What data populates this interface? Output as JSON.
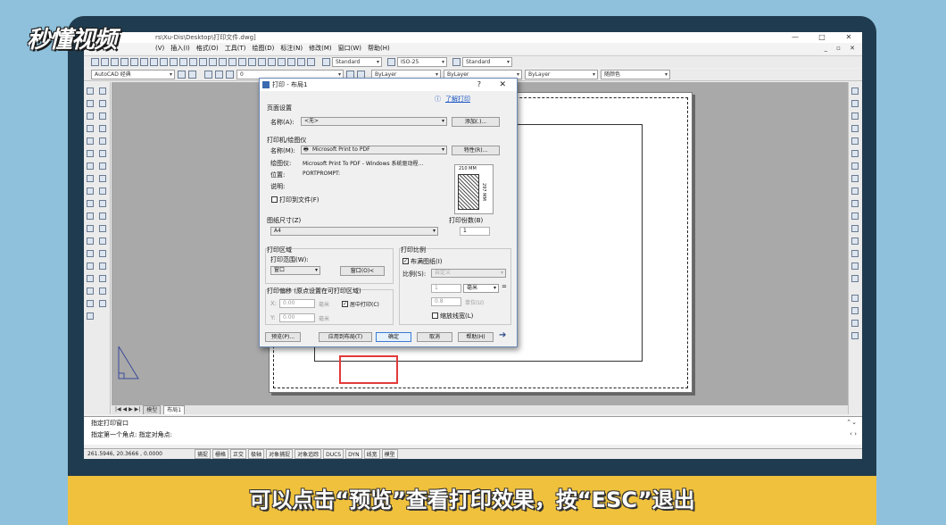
{
  "logo": {
    "text": "秒懂视频"
  },
  "titlebar": {
    "title": "rs\\Xu-Dis\\Desktop\\打印文件.dwg]",
    "min": "—",
    "max": "□",
    "close": "✕"
  },
  "menubar": {
    "items": [
      "(V)",
      "插入(I)",
      "格式(O)",
      "工具(T)",
      "绘图(D)",
      "标注(N)",
      "修改(M)",
      "窗口(W)",
      "帮助(H)"
    ],
    "mdi_controls": "_ ▫ ✕"
  },
  "toolbar1": {
    "style_text": "Standard",
    "dim_style": "ISO-25",
    "table_style": "Standard"
  },
  "toolbar2": {
    "workspace": "AutoCAD 经典",
    "layer": "0",
    "color": "ByLayer",
    "linetype": "ByLayer",
    "lineweight": "ByLayer",
    "plotstyle": "随颜色"
  },
  "layout_tabs": {
    "nav": "|◀ ◀ ▶ ▶|",
    "tabs": [
      "模型",
      "布局1"
    ]
  },
  "command": {
    "line1": "指定打印窗口",
    "line2": "指定第一个角点: 指定对角点:"
  },
  "status": {
    "coords": "261.5946, 20.3666 , 0.0000",
    "toggles": [
      "捕捉",
      "栅格",
      "正交",
      "极轴",
      "对象捕捉",
      "对象追踪",
      "DUCS",
      "DYN",
      "线宽",
      "模型"
    ]
  },
  "dialog": {
    "title": "打印 - 布局1",
    "help_q": "?",
    "close": "✕",
    "learn_link": "了解打印",
    "page_setup": {
      "group": "页面设置",
      "name_label": "名称(A):",
      "name_value": "<无>",
      "add_btn": "添加(.)..."
    },
    "printer": {
      "group": "打印机/绘图仪",
      "name_label": "名称(M):",
      "name_value": "Microsoft Print to PDF",
      "props_btn": "特性(R)...",
      "plotter_label": "绘图仪:",
      "plotter_value": "Microsoft Print To PDF - Windows 系统驱动程...",
      "location_label": "位置:",
      "location_value": "PORTPROMPT:",
      "desc_label": "说明:",
      "print_to_file": "打印到文件(F)",
      "paper_w": "210 MM",
      "paper_h": "297 MM"
    },
    "paper_size": {
      "group": "图纸尺寸(Z)",
      "value": "A4"
    },
    "copies": {
      "group": "打印份数(B)",
      "value": "1"
    },
    "area": {
      "group": "打印区域",
      "range_label": "打印范围(W):",
      "range_value": "窗口",
      "window_btn": "窗口(O)<"
    },
    "scale": {
      "group": "打印比例",
      "fit": "布满图纸(I)",
      "ratio_label": "比例(S):",
      "ratio_value": "自定义",
      "v1": "1",
      "unit": "毫米",
      "eq": "=",
      "v2": "0.8",
      "unit2": "单位(U)",
      "scale_lw": "缩放线宽(L)"
    },
    "offset": {
      "group": "打印偏移 (原点设置在可打印区域)",
      "x_label": "X:",
      "x_value": "0.00",
      "x_unit": "毫米",
      "center": "居中打印(C)",
      "y_label": "Y:",
      "y_value": "0.00",
      "y_unit": "毫米"
    },
    "buttons": {
      "preview": "预览(P)...",
      "apply": "应用到布局(T)",
      "ok": "确定",
      "cancel": "取消",
      "help": "帮助(H)"
    }
  },
  "caption": {
    "text": "可以点击“预览”查看打印效果，按“ESC”退出"
  }
}
